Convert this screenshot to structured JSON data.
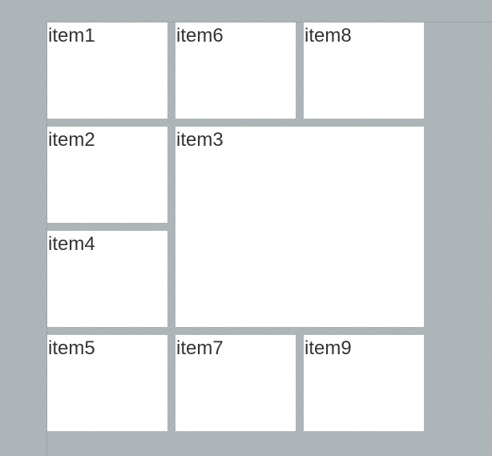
{
  "grid": {
    "items": [
      {
        "id": "item1",
        "label": "item1"
      },
      {
        "id": "item2",
        "label": "item2"
      },
      {
        "id": "item3",
        "label": "item3"
      },
      {
        "id": "item4",
        "label": "item4"
      },
      {
        "id": "item5",
        "label": "item5"
      },
      {
        "id": "item6",
        "label": "item6"
      },
      {
        "id": "item7",
        "label": "item7"
      },
      {
        "id": "item8",
        "label": "item8"
      },
      {
        "id": "item9",
        "label": "item9"
      }
    ]
  },
  "colors": {
    "background": "#adb5b8",
    "item_background": "#ffffff",
    "item_text": "#333333"
  }
}
